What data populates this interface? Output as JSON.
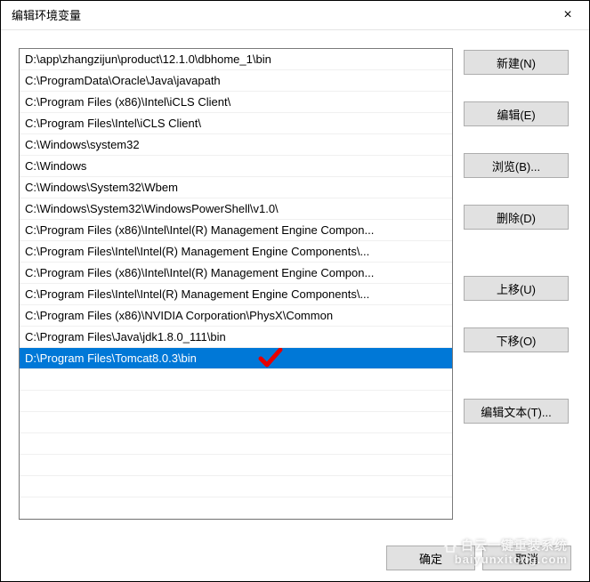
{
  "window": {
    "title": "编辑环境变量",
    "close_symbol": "×"
  },
  "list": {
    "items": [
      "D:\\app\\zhangzijun\\product\\12.1.0\\dbhome_1\\bin",
      "C:\\ProgramData\\Oracle\\Java\\javapath",
      "C:\\Program Files (x86)\\Intel\\iCLS Client\\",
      "C:\\Program Files\\Intel\\iCLS Client\\",
      "C:\\Windows\\system32",
      "C:\\Windows",
      "C:\\Windows\\System32\\Wbem",
      "C:\\Windows\\System32\\WindowsPowerShell\\v1.0\\",
      "C:\\Program Files (x86)\\Intel\\Intel(R) Management Engine Compon...",
      "C:\\Program Files\\Intel\\Intel(R) Management Engine Components\\...",
      "C:\\Program Files (x86)\\Intel\\Intel(R) Management Engine Compon...",
      "C:\\Program Files\\Intel\\Intel(R) Management Engine Components\\...",
      "C:\\Program Files (x86)\\NVIDIA Corporation\\PhysX\\Common",
      "C:\\Program Files\\Java\\jdk1.8.0_111\\bin",
      "D:\\Program Files\\Tomcat8.0.3\\bin"
    ],
    "selected_index": 14
  },
  "buttons": {
    "new": "新建(N)",
    "edit": "编辑(E)",
    "browse": "浏览(B)...",
    "delete": "删除(D)",
    "move_up": "上移(U)",
    "move_down": "下移(O)",
    "edit_text": "编辑文本(T)...",
    "ok": "确定",
    "cancel": "取消"
  },
  "watermark": {
    "line1": "白云一键重装系统",
    "line2": "baiyunxitong.com"
  },
  "annotation": {
    "checkmark_color": "#e60000"
  }
}
